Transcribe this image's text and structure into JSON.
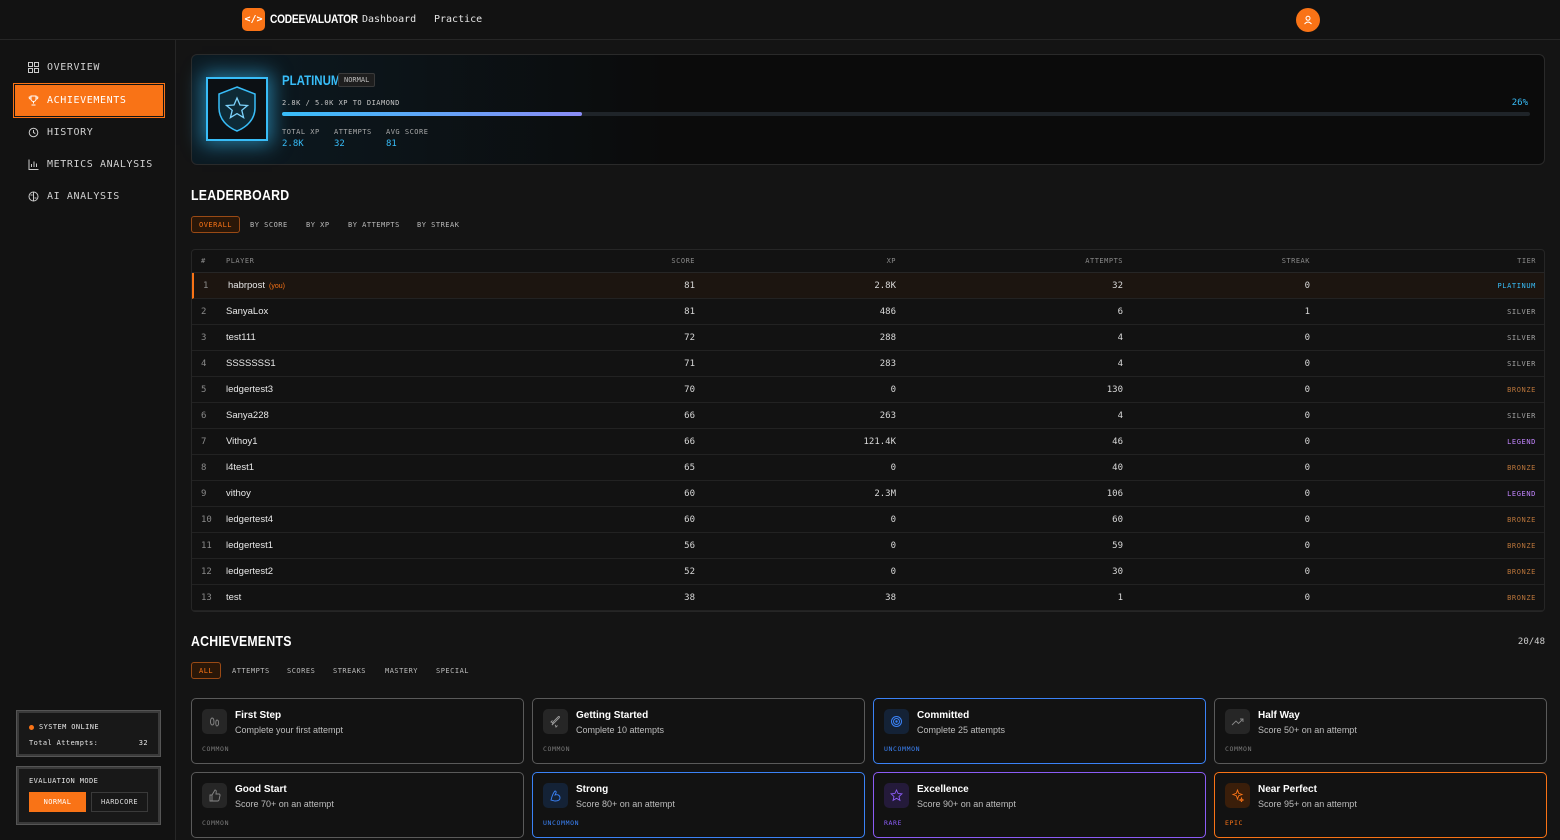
{
  "colors": {
    "accent": "#f97316",
    "platinum": "#38bdf8",
    "silver": "#a3a3a3",
    "bronze": "#b8743a",
    "legend": "#c084fc",
    "uncommon": "#3b82f6",
    "rare": "#8b5cf6",
    "epic": "#f97316",
    "common": "#555555"
  },
  "header": {
    "logo_glyph": "</>",
    "brand": "CODEEVALUATOR",
    "nav": [
      "Dashboard",
      "Practice"
    ]
  },
  "sidebar": {
    "items": [
      {
        "label": "OVERVIEW",
        "icon": "grid-icon"
      },
      {
        "label": "ACHIEVEMENTS",
        "icon": "trophy-icon",
        "active": true
      },
      {
        "label": "HISTORY",
        "icon": "history-icon"
      },
      {
        "label": "METRICS ANALYSIS",
        "icon": "bar-chart-icon"
      },
      {
        "label": "AI ANALYSIS",
        "icon": "brain-icon"
      }
    ],
    "status": {
      "label": "SYSTEM ONLINE",
      "attempts_label": "Total Attempts:",
      "attempts_value": "32"
    },
    "mode": {
      "label": "EVALUATION MODE",
      "options": [
        "NORMAL",
        "HARDCORE"
      ],
      "selected": "NORMAL"
    }
  },
  "tier": {
    "name": "PLATINUM",
    "mode": "NORMAL",
    "progress_text": "2.8K / 5.0K XP TO DIAMOND",
    "progress_pct": "26%",
    "progress_fraction": 0.24,
    "stats": [
      {
        "label": "TOTAL XP",
        "value": "2.8K"
      },
      {
        "label": "ATTEMPTS",
        "value": "32"
      },
      {
        "label": "AVG SCORE",
        "value": "81"
      }
    ]
  },
  "leaderboard": {
    "title": "LEADERBOARD",
    "tabs": [
      "OVERALL",
      "BY SCORE",
      "BY XP",
      "BY ATTEMPTS",
      "BY STREAK"
    ],
    "columns": [
      "#",
      "PLAYER",
      "SCORE",
      "XP",
      "ATTEMPTS",
      "STREAK",
      "TIER"
    ],
    "you_tag": "(you)",
    "rows": [
      {
        "rank": "1",
        "player": "habrpost",
        "score": "81",
        "xp": "2.8K",
        "attempts": "32",
        "streak": "0",
        "tier": "PLATINUM",
        "you": true
      },
      {
        "rank": "2",
        "player": "SanyaLox",
        "score": "81",
        "xp": "486",
        "attempts": "6",
        "streak": "1",
        "tier": "SILVER"
      },
      {
        "rank": "3",
        "player": "test111",
        "score": "72",
        "xp": "288",
        "attempts": "4",
        "streak": "0",
        "tier": "SILVER"
      },
      {
        "rank": "4",
        "player": "SSSSSSS1",
        "score": "71",
        "xp": "283",
        "attempts": "4",
        "streak": "0",
        "tier": "SILVER"
      },
      {
        "rank": "5",
        "player": "ledgertest3",
        "score": "70",
        "xp": "0",
        "attempts": "130",
        "streak": "0",
        "tier": "BRONZE"
      },
      {
        "rank": "6",
        "player": "Sanya228",
        "score": "66",
        "xp": "263",
        "attempts": "4",
        "streak": "0",
        "tier": "SILVER"
      },
      {
        "rank": "7",
        "player": "Vithoy1",
        "score": "66",
        "xp": "121.4K",
        "attempts": "46",
        "streak": "0",
        "tier": "LEGEND"
      },
      {
        "rank": "8",
        "player": "l4test1",
        "score": "65",
        "xp": "0",
        "attempts": "40",
        "streak": "0",
        "tier": "BRONZE"
      },
      {
        "rank": "9",
        "player": "vithoy",
        "score": "60",
        "xp": "2.3M",
        "attempts": "106",
        "streak": "0",
        "tier": "LEGEND"
      },
      {
        "rank": "10",
        "player": "ledgertest4",
        "score": "60",
        "xp": "0",
        "attempts": "60",
        "streak": "0",
        "tier": "BRONZE"
      },
      {
        "rank": "11",
        "player": "ledgertest1",
        "score": "56",
        "xp": "0",
        "attempts": "59",
        "streak": "0",
        "tier": "BRONZE"
      },
      {
        "rank": "12",
        "player": "ledgertest2",
        "score": "52",
        "xp": "0",
        "attempts": "30",
        "streak": "0",
        "tier": "BRONZE"
      },
      {
        "rank": "13",
        "player": "test",
        "score": "38",
        "xp": "38",
        "attempts": "1",
        "streak": "0",
        "tier": "BRONZE"
      }
    ]
  },
  "achievements": {
    "title": "ACHIEVEMENTS",
    "count": "20/48",
    "tabs": [
      "ALL",
      "ATTEMPTS",
      "SCORES",
      "STREAKS",
      "MASTERY",
      "SPECIAL"
    ],
    "cards": [
      {
        "title": "First Step",
        "desc": "Complete your first attempt",
        "rarity": "COMMON",
        "icon": "footprints-icon"
      },
      {
        "title": "Getting Started",
        "desc": "Complete 10 attempts",
        "rarity": "COMMON",
        "icon": "rocket-icon"
      },
      {
        "title": "Committed",
        "desc": "Complete 25 attempts",
        "rarity": "UNCOMMON",
        "icon": "target-icon"
      },
      {
        "title": "Half Way",
        "desc": "Score 50+ on an attempt",
        "rarity": "COMMON",
        "icon": "trending-up-icon"
      },
      {
        "title": "Good Start",
        "desc": "Score 70+ on an attempt",
        "rarity": "COMMON",
        "icon": "thumbs-up-icon"
      },
      {
        "title": "Strong",
        "desc": "Score 80+ on an attempt",
        "rarity": "UNCOMMON",
        "icon": "muscle-icon"
      },
      {
        "title": "Excellence",
        "desc": "Score 90+ on an attempt",
        "rarity": "RARE",
        "icon": "star-icon"
      },
      {
        "title": "Near Perfect",
        "desc": "Score 95+ on an attempt",
        "rarity": "EPIC",
        "icon": "sparkles-icon"
      }
    ]
  }
}
